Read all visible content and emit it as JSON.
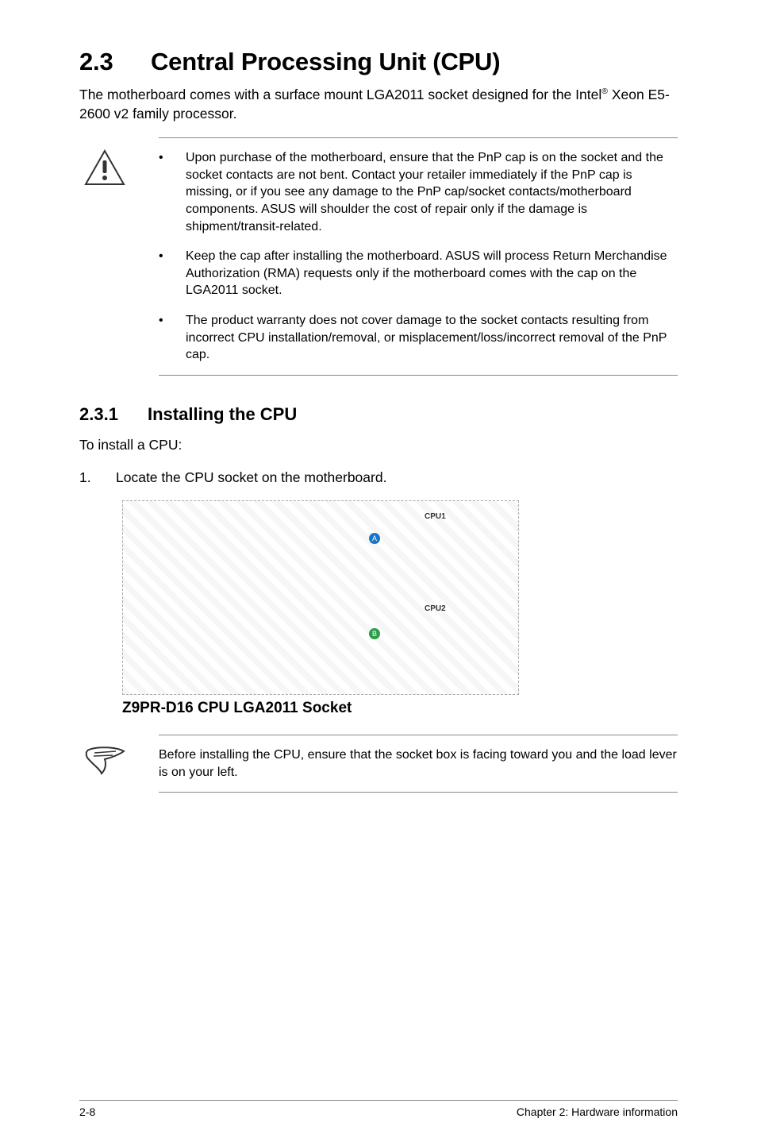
{
  "heading": {
    "number": "2.3",
    "title": "Central Processing Unit (CPU)"
  },
  "intro": {
    "part1": "The motherboard comes with a surface mount LGA2011 socket designed for the Intel",
    "sup": "®",
    "part2": " Xeon E5-2600 v2 family processor."
  },
  "caution_bullets": [
    "Upon purchase of the motherboard, ensure that the PnP cap is on the socket and the socket contacts are not bent. Contact your retailer immediately if the PnP cap is missing, or if you see any damage to the PnP cap/socket contacts/motherboard components. ASUS will shoulder the cost of repair only if the damage is shipment/transit-related.",
    "Keep the cap after installing the motherboard. ASUS will process Return Merchandise Authorization (RMA) requests only if the motherboard comes with the cap on the LGA2011 socket.",
    "The product warranty does not cover damage to the socket contacts resulting from incorrect CPU installation/removal, or misplacement/loss/incorrect removal of the PnP cap."
  ],
  "subheading": {
    "number": "2.3.1",
    "title": "Installing the CPU"
  },
  "preline": "To install a CPU:",
  "step1": {
    "num": "1.",
    "text": "Locate the CPU socket on the motherboard."
  },
  "diagram": {
    "caption": "Z9PR-D16 CPU LGA2011 Socket",
    "cpu1": "CPU1",
    "cpu2": "CPU2",
    "a": "A",
    "b": "B"
  },
  "note": "Before installing the CPU, ensure that the socket box is facing toward you and the load lever is on your left.",
  "footer": {
    "left": "2-8",
    "right": "Chapter 2: Hardware information"
  },
  "glyphs": {
    "bullet": "•"
  }
}
